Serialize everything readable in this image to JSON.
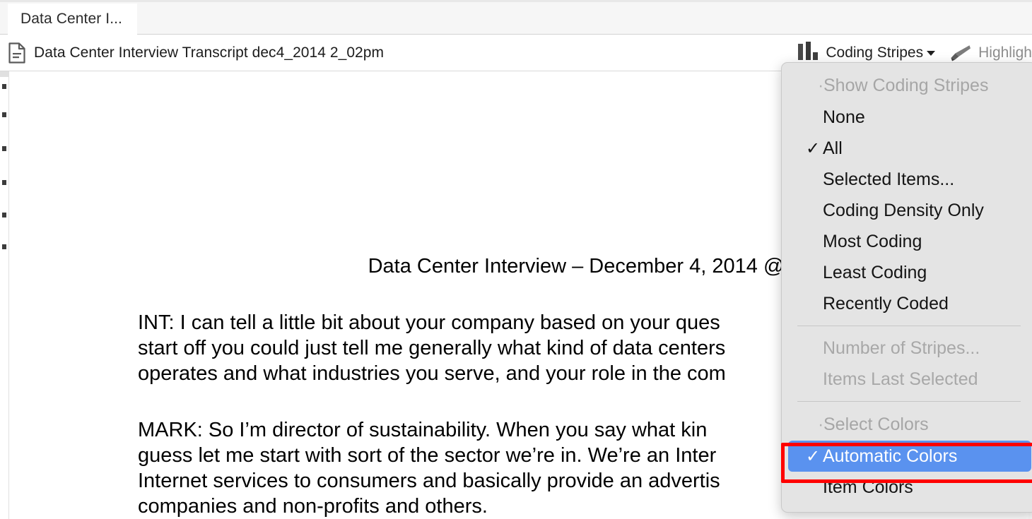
{
  "window": {
    "tab": {
      "label": "Data Center I..."
    }
  },
  "document_header": {
    "icon": "document-icon",
    "title": "Data Center Interview Transcript dec4_2014 2_02pm"
  },
  "toolbar": {
    "coding_stripes": {
      "icon": "coding-stripes-icon",
      "label": "Coding Stripes",
      "caret": "chevron-down-icon"
    },
    "highlight": {
      "icon": "highlighter-icon",
      "label": "Highligh"
    }
  },
  "document": {
    "title": "Data Center Interview – December 4, 2014 @",
    "paragraphs": [
      "INT:  I can tell a little bit about your company based on your ques start off you could just tell me generally what kind of data centers operates and what industries you serve, and your role in the com",
      "MARK:  So I’m director of sustainability.  When you say what kin guess let me start with sort of the sector we’re in.  We’re an Inter Internet services to consumers and basically provide an advertis companies and non-profits and others."
    ],
    "paragraph_lines": [
      [
        "INT:  I can tell a little bit about your company based on your ques",
        "start off you could just tell me generally what kind of data centers",
        "operates and what industries you serve, and your role in the com"
      ],
      [
        "MARK:  So I’m director of sustainability.  When you say what kin",
        "guess let me start with sort of the sector we’re in.  We’re an Inter",
        "Internet services to consumers and basically provide an advertis",
        "companies and non-profits and others."
      ]
    ]
  },
  "coding_stripes_menu": {
    "groups": [
      {
        "header": {
          "label": "Show Coding Stripes",
          "bullet": "·",
          "enabled": false
        },
        "items": [
          {
            "label": "None",
            "checked": false,
            "enabled": true,
            "selected": false
          },
          {
            "label": "All",
            "checked": true,
            "enabled": true,
            "selected": false
          },
          {
            "label": "Selected Items...",
            "checked": false,
            "enabled": true,
            "selected": false
          },
          {
            "label": "Coding Density Only",
            "checked": false,
            "enabled": true,
            "selected": false
          },
          {
            "label": "Most Coding",
            "checked": false,
            "enabled": true,
            "selected": false
          },
          {
            "label": "Least Coding",
            "checked": false,
            "enabled": true,
            "selected": false
          },
          {
            "label": "Recently Coded",
            "checked": false,
            "enabled": true,
            "selected": false
          }
        ]
      },
      {
        "header": null,
        "items": [
          {
            "label": "Number of Stripes...",
            "checked": false,
            "enabled": false,
            "selected": false
          },
          {
            "label": "Items Last Selected",
            "checked": false,
            "enabled": false,
            "selected": false
          }
        ]
      },
      {
        "header": {
          "label": "Select Colors",
          "bullet": "·",
          "enabled": false
        },
        "items": [
          {
            "label": "Automatic Colors",
            "checked": true,
            "enabled": true,
            "selected": true
          },
          {
            "label": "Item Colors",
            "checked": false,
            "enabled": true,
            "selected": false
          }
        ]
      }
    ],
    "checkmark": "✓"
  },
  "annotation": {
    "highlight_box_color": "#ff0000",
    "highlight_target": "Automatic Colors"
  },
  "colors": {
    "menu_background": "#e4e4e4",
    "selection_blue": "#5a92ef",
    "disabled_text": "#a8a8a8",
    "tab_bar": "#f6f6f6",
    "annotation_red": "#ff0000"
  }
}
